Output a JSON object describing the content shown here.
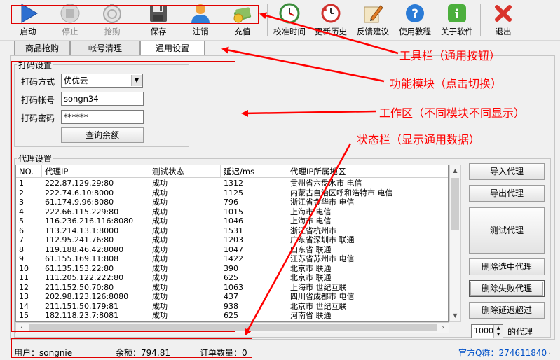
{
  "toolbar": {
    "buttons": [
      {
        "label": "启动",
        "icon": "play-icon",
        "disabled": false
      },
      {
        "label": "停止",
        "icon": "stop-icon",
        "disabled": true
      },
      {
        "label": "抢购",
        "icon": "buy-icon",
        "disabled": true
      },
      {
        "label": "保存",
        "icon": "save-icon",
        "disabled": false
      },
      {
        "label": "注销",
        "icon": "user-icon",
        "disabled": false
      },
      {
        "label": "充值",
        "icon": "money-icon",
        "disabled": false
      },
      {
        "label": "校准时间",
        "icon": "clock-icon",
        "disabled": false
      },
      {
        "label": "更新历史",
        "icon": "history-icon",
        "disabled": false
      },
      {
        "label": "反馈建议",
        "icon": "pencil-icon",
        "disabled": false
      },
      {
        "label": "使用教程",
        "icon": "help-icon",
        "disabled": false
      },
      {
        "label": "关于软件",
        "icon": "info-icon",
        "disabled": false
      },
      {
        "label": "退出",
        "icon": "close-icon",
        "disabled": false
      }
    ]
  },
  "tabs": [
    {
      "label": "商品抢购",
      "active": false
    },
    {
      "label": "帐号清理",
      "active": false
    },
    {
      "label": "通用设置",
      "active": true
    }
  ],
  "captcha": {
    "group_title": "打码设置",
    "method_label": "打码方式",
    "method_value": "优优云",
    "account_label": "打码帐号",
    "account_value": "songn34",
    "password_label": "打码密码",
    "password_value": "******",
    "query_button": "查询余额"
  },
  "proxy": {
    "group_title": "代理设置",
    "columns": [
      "NO.",
      "代理IP",
      "测试状态",
      "延迟/ms",
      "代理IP所属地区"
    ],
    "rows": [
      [
        "1",
        "222.87.129.29:80",
        "成功",
        "1312",
        "贵州省六盘水市 电信"
      ],
      [
        "2",
        "222.74.6.10:8000",
        "成功",
        "1125",
        "内蒙古自治区呼和浩特市 电信"
      ],
      [
        "3",
        "61.174.9.96:8080",
        "成功",
        "796",
        "浙江省金华市 电信"
      ],
      [
        "4",
        "222.66.115.229:80",
        "成功",
        "1015",
        "上海市 电信"
      ],
      [
        "5",
        "116.236.216.116:8080",
        "成功",
        "1046",
        "上海市 电信"
      ],
      [
        "6",
        "113.214.13.1:8000",
        "成功",
        "1531",
        "浙江省杭州市"
      ],
      [
        "7",
        "112.95.241.76:80",
        "成功",
        "1203",
        "广东省深圳市 联通"
      ],
      [
        "8",
        "119.188.46.42:8080",
        "成功",
        "1047",
        "山东省 联通"
      ],
      [
        "9",
        "61.155.169.11:808",
        "成功",
        "1422",
        "江苏省苏州市 电信"
      ],
      [
        "10",
        "61.135.153.22:80",
        "成功",
        "390",
        "北京市 联通"
      ],
      [
        "11",
        "111.205.122.222:80",
        "成功",
        "625",
        "北京市 联通"
      ],
      [
        "12",
        "211.152.50.70:80",
        "成功",
        "1063",
        "上海市 世纪互联"
      ],
      [
        "13",
        "202.98.123.126:8080",
        "成功",
        "437",
        "四川省成都市 电信"
      ],
      [
        "14",
        "211.151.50.179:81",
        "成功",
        "938",
        "北京市 世纪互联"
      ],
      [
        "15",
        "182.118.23.7:8081",
        "成功",
        "625",
        "河南省 联通"
      ]
    ],
    "buttons": {
      "import": "导入代理",
      "export": "导出代理",
      "test": "测试代理",
      "delete_selected": "删除选中代理",
      "delete_failed": "删除失败代理",
      "delete_timeout": "删除延迟超过"
    },
    "timeout_value": "1000",
    "timeout_suffix": "的代理"
  },
  "status": {
    "user": "用户：songnie",
    "balance": "余额：794.81",
    "orders": "订单数量：0",
    "qq": "官方Q群：274611840"
  },
  "annotations": {
    "toolbar": "工具栏（通用按钮）",
    "modules": "功能模块（点击切换）",
    "workarea": "工作区（不同模块不同显示）",
    "statusbar": "状态栏（显示通用数据）"
  },
  "colors": {
    "annotation": "#ff0000",
    "qq_link": "#0050c8"
  }
}
